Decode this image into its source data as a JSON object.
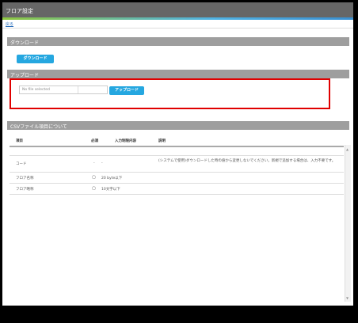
{
  "window": {
    "title": "フロア設定"
  },
  "nav": {
    "back_label": "戻る"
  },
  "download": {
    "section_title": "ダウンロード",
    "button_label": "ダウンロード"
  },
  "upload": {
    "section_title": "アップロード",
    "file_placeholder": "No file selected",
    "button_label": "アップロード"
  },
  "csv_info": {
    "section_title": "CSVファイル項目について",
    "columns": [
      "項目",
      "必須",
      "入力制限内容",
      "説明"
    ],
    "rows": [
      {
        "item": "コード",
        "required": "-",
        "limit": "-",
        "desc": "(システムで使用)ダウンロードした時の値から変更しないでください。新規で追加する場合は、入力不要です。"
      },
      {
        "item": "フロア名称",
        "required": "◯",
        "limit": "20 byte以下",
        "desc": ""
      },
      {
        "item": "フロア略称",
        "required": "◯",
        "limit": "10文字以下",
        "desc": ""
      }
    ]
  },
  "colors": {
    "accent_blue": "#25a7e0",
    "highlight_red": "#e00000",
    "section_gray": "#9e9e9e"
  }
}
